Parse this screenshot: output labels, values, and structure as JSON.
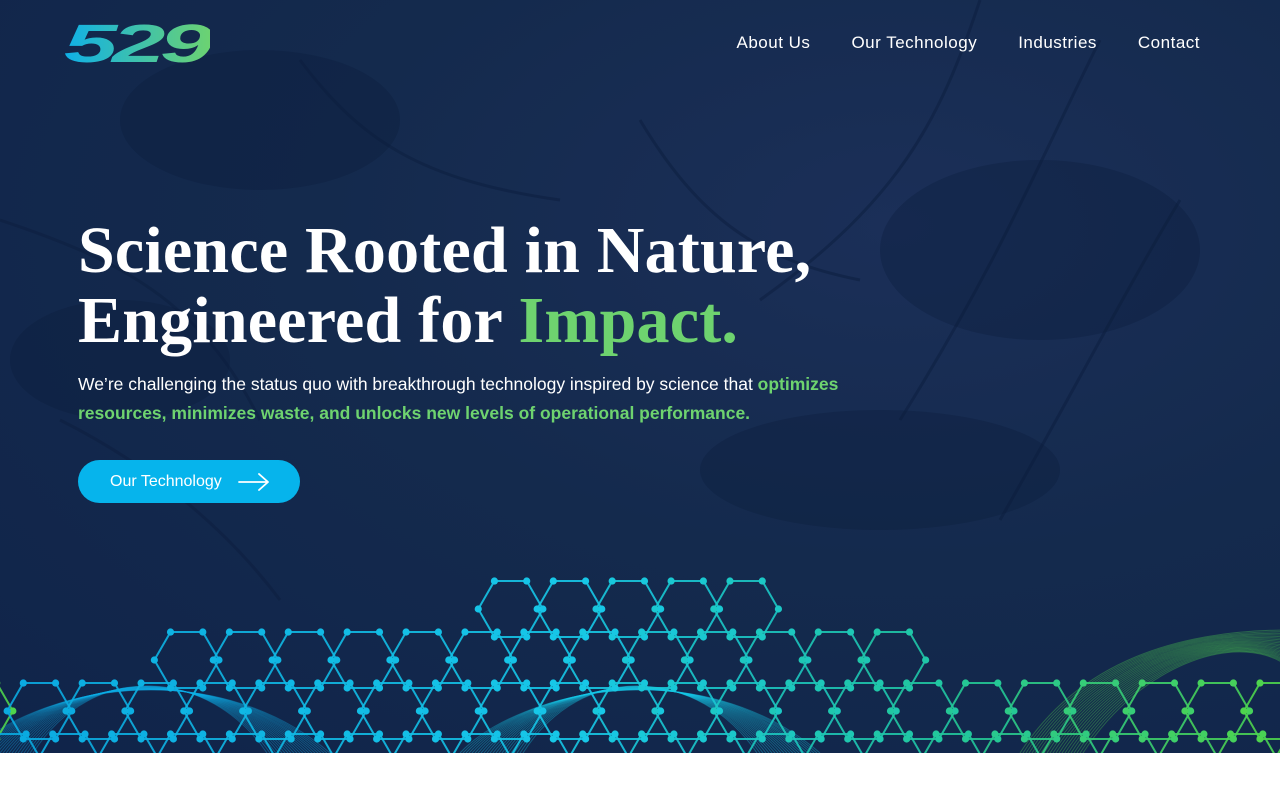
{
  "brand": {
    "logo_text": "529",
    "logo_gradient": [
      "#0fb0e8",
      "#6ed36f"
    ]
  },
  "nav": {
    "items": [
      {
        "label": "About Us",
        "name": "nav-about-us"
      },
      {
        "label": "Our Technology",
        "name": "nav-our-technology"
      },
      {
        "label": "Industries",
        "name": "nav-industries"
      },
      {
        "label": "Contact",
        "name": "nav-contact"
      }
    ]
  },
  "hero": {
    "headline_line1": "Science Rooted in Nature,",
    "headline_line2_prefix": "Engineered for ",
    "headline_line2_accent": "Impact.",
    "subtext_plain": "We’re challenging the status quo with breakthrough technology inspired by science that ",
    "subtext_accent": "optimizes resources, minimizes waste, and unlocks new levels of operational performance.",
    "cta_label": "Our Technology",
    "cta_icon": "arrow-right-icon"
  },
  "colors": {
    "background": "#142a4d",
    "accent_green": "#6ed36f",
    "accent_blue": "#06b4ec",
    "text": "#ffffff"
  }
}
